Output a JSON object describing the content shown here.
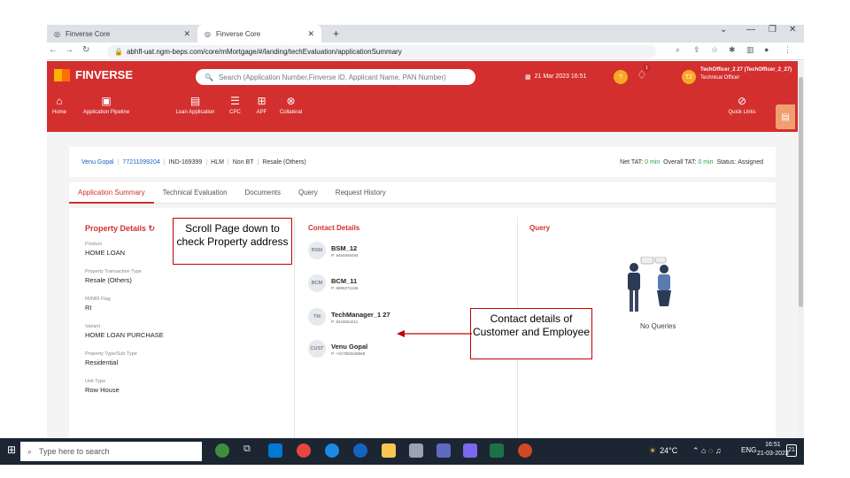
{
  "browser": {
    "tabs": [
      {
        "title": "Finverse Core"
      },
      {
        "title": "Finverse Core"
      }
    ],
    "new_tab": "+",
    "url": "abhfl-uat.ngm-beps.com/core/mMortgage/#/landing/techEvaluation/applicationSummary"
  },
  "header": {
    "logo": "FINVERSE",
    "search_placeholder": "Search (Application Number,Finverse ID, Applicant Name, PAN Number)",
    "datetime": "21 Mar 2023 16:51",
    "notif_count": "1",
    "avatar": "T2",
    "user_name": "TechOfficer_2 27 (TechOfficer_2_27)",
    "user_role": "Technical Officer",
    "nav": [
      "Home",
      "Application Pipeline",
      "Loan Application",
      "CPC",
      "APF",
      "Collateral"
    ],
    "quick_links": "Quick Links"
  },
  "info": {
    "name": "Venu Gopal",
    "phone": "7721109920​4",
    "id": "IND-169399",
    "product": "HLM",
    "bt": "Non BT",
    "type": "Resale (Others)",
    "net_tat_label": "Net TAT:",
    "net_tat": "0 min",
    "overall_tat_label": "Overall TAT:",
    "overall_tat": "0 min",
    "status_label": "Status:",
    "status": "Assigned"
  },
  "tabs": [
    "Application Summary",
    "Technical Evaluation",
    "Documents",
    "Query",
    "Request History"
  ],
  "property": {
    "title": "Property Details",
    "fields": [
      {
        "label": "Product",
        "value": "HOME LOAN"
      },
      {
        "label": "Property Transaction Type",
        "value": "Resale (Others)"
      },
      {
        "label": "RI/NRI Flag",
        "value": "RI"
      },
      {
        "label": "Variant",
        "value": "HOME LOAN PURCHASE"
      },
      {
        "label": "Property Type/Sub Type",
        "value": "Residential"
      },
      {
        "label": "Unit Type",
        "value": "Row House"
      }
    ]
  },
  "contacts": {
    "title": "Contact Details",
    "items": [
      {
        "avatar": "BSM",
        "name": "BSM_12",
        "phone": "P: 9494949494"
      },
      {
        "avatar": "BCM",
        "name": "BCM_11",
        "phone": "P: 8898271159"
      },
      {
        "avatar": "TM",
        "name": "TechManager_1 27",
        "phone": "P: 9443654211"
      },
      {
        "avatar": "CUST",
        "name": "Venu Gopal",
        "phone": "P: +917982648568"
      }
    ]
  },
  "query": {
    "title": "Query",
    "empty": "No Queries"
  },
  "callouts": {
    "scroll": "Scroll Page down to check Property address",
    "contact": "Contact details of Customer and Employee"
  },
  "taskbar": {
    "search": "Type here to search",
    "weather": "24°C",
    "lang": "ENG",
    "time": "16:51",
    "date": "21-03-2023",
    "notif": "21"
  },
  "colors": {
    "brand": "#d32f2f",
    "accent_green": "#2e9e44"
  }
}
